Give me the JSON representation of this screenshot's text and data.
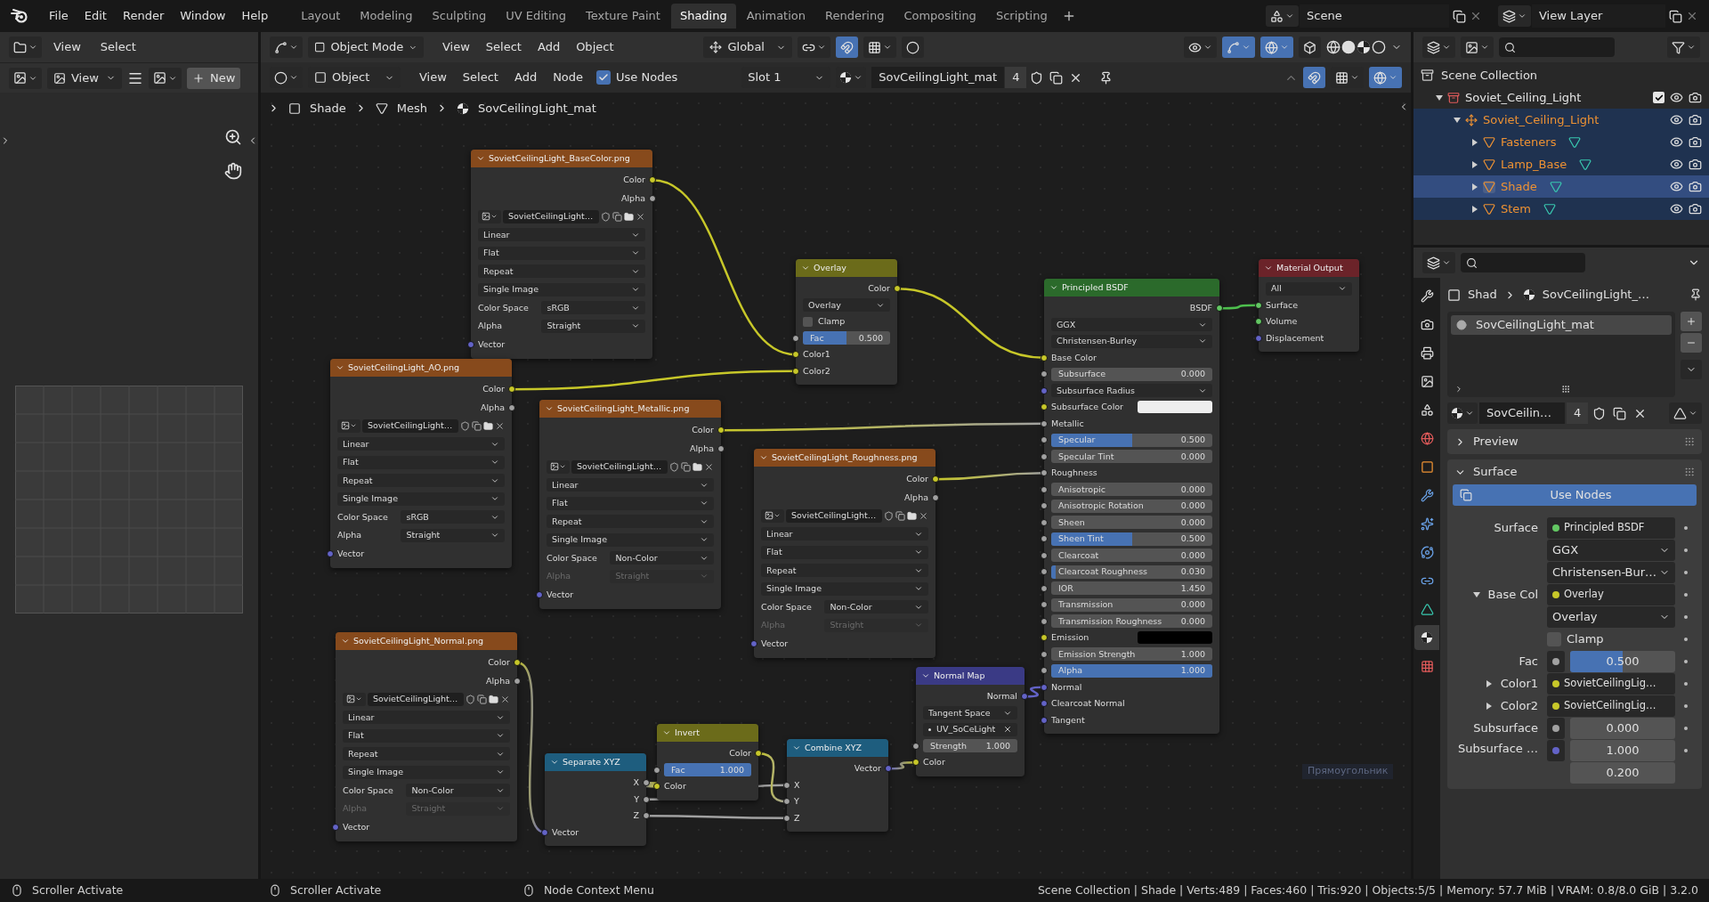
{
  "menu": [
    "File",
    "Edit",
    "Render",
    "Window",
    "Help"
  ],
  "workspaces": [
    {
      "label": "Layout",
      "selected": false
    },
    {
      "label": "Modeling",
      "selected": false
    },
    {
      "label": "Sculpting",
      "selected": false
    },
    {
      "label": "UV Editing",
      "selected": false
    },
    {
      "label": "Texture Paint",
      "selected": false
    },
    {
      "label": "Shading",
      "selected": true
    },
    {
      "label": "Animation",
      "selected": false
    },
    {
      "label": "Rendering",
      "selected": false
    },
    {
      "label": "Compositing",
      "selected": false
    },
    {
      "label": "Scripting",
      "selected": false
    }
  ],
  "scene": "Scene",
  "view_layer": "View Layer",
  "image_editor": {
    "menus": [
      "View",
      "Select"
    ],
    "view": "View",
    "new_button": "New"
  },
  "node_editor": {
    "mode": "Object Mode",
    "menus": [
      "View",
      "Select",
      "Add",
      "Object"
    ],
    "orientation": "Global",
    "shader_type": "Object",
    "node_menus": [
      "View",
      "Select",
      "Add",
      "Node"
    ],
    "use_nodes": {
      "label": "Use Nodes",
      "checked": true
    },
    "slot": "Slot 1",
    "material": "SovCeilingLight_mat",
    "users": "4",
    "breadcrumbs": [
      "Shade",
      "Mesh",
      "SovCeilingLight_mat"
    ],
    "nodes": [
      {
        "title": "SovietCeilingLight_BaseColor.png",
        "kind": "texture",
        "rows": [
          {
            "kind": "output",
            "label": "Color",
            "socket": {
              "color": "#c7c729"
            }
          },
          {
            "kind": "output",
            "label": "Alpha",
            "socket": {
              "color": "#a1a1a1"
            }
          },
          {
            "kind": "image",
            "value": "SovietCeilingLight…"
          },
          {
            "kind": "dropdown",
            "value": "Linear"
          },
          {
            "kind": "dropdown",
            "value": "Flat"
          },
          {
            "kind": "dropdown",
            "value": "Repeat"
          },
          {
            "kind": "dropdown",
            "value": "Single Image"
          },
          {
            "kind": "field",
            "label": "Color Space",
            "value": "sRGB",
            "disabled": false
          },
          {
            "kind": "field",
            "label": "Alpha",
            "value": "Straight",
            "disabled": false
          },
          {
            "kind": "input",
            "label": "Vector",
            "socket": {
              "color": "#6363c7"
            }
          }
        ]
      },
      {
        "title": "SovietCeilingLight_AO.png",
        "kind": "texture",
        "rows": [
          {
            "kind": "output",
            "label": "Color",
            "socket": {
              "color": "#c7c729"
            }
          },
          {
            "kind": "output",
            "label": "Alpha",
            "socket": {
              "color": "#a1a1a1"
            }
          },
          {
            "kind": "image",
            "value": "SovietCeilingLight…"
          },
          {
            "kind": "dropdown",
            "value": "Linear"
          },
          {
            "kind": "dropdown",
            "value": "Flat"
          },
          {
            "kind": "dropdown",
            "value": "Repeat"
          },
          {
            "kind": "dropdown",
            "value": "Single Image"
          },
          {
            "kind": "field",
            "label": "Color Space",
            "value": "sRGB",
            "disabled": false
          },
          {
            "kind": "field",
            "label": "Alpha",
            "value": "Straight",
            "disabled": false
          },
          {
            "kind": "input",
            "label": "Vector",
            "socket": {
              "color": "#6363c7"
            }
          }
        ]
      },
      {
        "title": "SovietCeilingLight_Metallic.png",
        "kind": "texture",
        "rows": [
          {
            "kind": "output",
            "label": "Color",
            "socket": {
              "color": "#c7c729"
            }
          },
          {
            "kind": "output",
            "label": "Alpha",
            "socket": {
              "color": "#a1a1a1"
            }
          },
          {
            "kind": "image",
            "value": "SovietCeilingLight…"
          },
          {
            "kind": "dropdown",
            "value": "Linear"
          },
          {
            "kind": "dropdown",
            "value": "Flat"
          },
          {
            "kind": "dropdown",
            "value": "Repeat"
          },
          {
            "kind": "dropdown",
            "value": "Single Image"
          },
          {
            "kind": "field",
            "label": "Color Space",
            "value": "Non-Color",
            "disabled": false
          },
          {
            "kind": "field",
            "label": "Alpha",
            "value": "Straight",
            "disabled": true
          },
          {
            "kind": "input",
            "label": "Vector",
            "socket": {
              "color": "#6363c7"
            }
          }
        ]
      },
      {
        "title": "SovietCeilingLight_Roughness.png",
        "kind": "texture",
        "rows": [
          {
            "kind": "output",
            "label": "Color",
            "socket": {
              "color": "#c7c729"
            }
          },
          {
            "kind": "output",
            "label": "Alpha",
            "socket": {
              "color": "#a1a1a1"
            }
          },
          {
            "kind": "image",
            "value": "SovietCeilingLight…"
          },
          {
            "kind": "dropdown",
            "value": "Linear"
          },
          {
            "kind": "dropdown",
            "value": "Flat"
          },
          {
            "kind": "dropdown",
            "value": "Repeat"
          },
          {
            "kind": "dropdown",
            "value": "Single Image"
          },
          {
            "kind": "field",
            "label": "Color Space",
            "value": "Non-Color",
            "disabled": false
          },
          {
            "kind": "field",
            "label": "Alpha",
            "value": "Straight",
            "disabled": true
          },
          {
            "kind": "input",
            "label": "Vector",
            "socket": {
              "color": "#6363c7"
            }
          }
        ]
      },
      {
        "title": "SovietCeilingLight_Normal.png",
        "kind": "texture",
        "rows": [
          {
            "kind": "output",
            "label": "Color",
            "socket": {
              "color": "#c7c729"
            }
          },
          {
            "kind": "output",
            "label": "Alpha",
            "socket": {
              "color": "#a1a1a1"
            }
          },
          {
            "kind": "image",
            "value": "SovietCeilingLight…"
          },
          {
            "kind": "dropdown",
            "value": "Linear"
          },
          {
            "kind": "dropdown",
            "value": "Flat"
          },
          {
            "kind": "dropdown",
            "value": "Repeat"
          },
          {
            "kind": "dropdown",
            "value": "Single Image"
          },
          {
            "kind": "field",
            "label": "Color Space",
            "value": "Non-Color",
            "disabled": false
          },
          {
            "kind": "field",
            "label": "Alpha",
            "value": "Straight",
            "disabled": true
          },
          {
            "kind": "input",
            "label": "Vector",
            "socket": {
              "color": "#6363c7"
            }
          }
        ]
      },
      {
        "title": "Overlay",
        "kind": "color",
        "rows": [
          {
            "kind": "output",
            "label": "Color",
            "socket": {
              "color": "#c7c729"
            }
          },
          {
            "kind": "dropdown",
            "value": "Overlay"
          },
          {
            "kind": "checkbox",
            "label": "Clamp",
            "checked": false
          },
          {
            "kind": "slider",
            "label": "Fac",
            "value": "0.500",
            "level": 0.5,
            "socket": {
              "color": "#a1a1a1"
            }
          },
          {
            "kind": "input",
            "label": "Color1",
            "socket": {
              "color": "#c7c729"
            }
          },
          {
            "kind": "input",
            "label": "Color2",
            "socket": {
              "color": "#c7c729"
            }
          }
        ]
      },
      {
        "title": "Separate XYZ",
        "kind": "converter",
        "rows": [
          {
            "kind": "output",
            "label": "X",
            "socket": {
              "color": "#a1a1a1"
            }
          },
          {
            "kind": "output",
            "label": "Y",
            "socket": {
              "color": "#a1a1a1"
            }
          },
          {
            "kind": "output",
            "label": "Z",
            "socket": {
              "color": "#a1a1a1"
            }
          },
          {
            "kind": "input",
            "label": "Vector",
            "socket": {
              "color": "#6363c7"
            }
          }
        ]
      },
      {
        "title": "Invert",
        "kind": "color",
        "rows": [
          {
            "kind": "output",
            "label": "Color",
            "socket": {
              "color": "#c7c729"
            }
          },
          {
            "kind": "slider",
            "label": "Fac",
            "value": "1.000",
            "level": 1,
            "socket": {
              "color": "#a1a1a1"
            }
          },
          {
            "kind": "input",
            "label": "Color",
            "socket": {
              "color": "#c7c729"
            }
          }
        ]
      },
      {
        "title": "Combine XYZ",
        "kind": "converter",
        "rows": [
          {
            "kind": "output",
            "label": "Vector",
            "socket": {
              "color": "#6363c7"
            }
          },
          {
            "kind": "input",
            "label": "X",
            "socket": {
              "color": "#a1a1a1"
            }
          },
          {
            "kind": "input",
            "label": "Y",
            "socket": {
              "color": "#a1a1a1"
            }
          },
          {
            "kind": "input",
            "label": "Z",
            "socket": {
              "color": "#a1a1a1"
            }
          }
        ]
      },
      {
        "title": "Normal Map",
        "kind": "vector",
        "rows": [
          {
            "kind": "output",
            "label": "Normal",
            "socket": {
              "color": "#6363c7"
            }
          },
          {
            "kind": "dropdown",
            "value": "Tangent Space"
          },
          {
            "kind": "uvmap",
            "value": "UV_SoCeLight"
          },
          {
            "kind": "number",
            "label": "Strength",
            "value": "1.000",
            "socket": {
              "color": "#a1a1a1"
            }
          },
          {
            "kind": "input",
            "label": "Color",
            "socket": {
              "color": "#c7c729"
            }
          }
        ]
      },
      {
        "title": "Principled BSDF",
        "kind": "shader",
        "rows": [
          {
            "kind": "output",
            "label": "BSDF",
            "socket": {
              "color": "#63c763"
            }
          },
          {
            "kind": "dropdown",
            "value": "GGX"
          },
          {
            "kind": "dropdown",
            "value": "Christensen-Burley"
          },
          {
            "kind": "input",
            "label": "Base Color",
            "socket": {
              "color": "#c7c729"
            }
          },
          {
            "kind": "number",
            "label": "Subsurface",
            "value": "0.000",
            "socket": {
              "color": "#a1a1a1"
            }
          },
          {
            "kind": "dropdown",
            "value": "Subsurface Radius",
            "socket": {
              "color": "#6363c7"
            }
          },
          {
            "kind": "swatch",
            "label": "Subsurface Color",
            "color": "#eeeeee",
            "socket": {
              "color": "#c7c729"
            }
          },
          {
            "kind": "input",
            "label": "Metallic",
            "socket": {
              "color": "#a1a1a1"
            }
          },
          {
            "kind": "slider",
            "label": "Specular",
            "value": "0.500",
            "level": 0.5,
            "socket": {
              "color": "#a1a1a1"
            }
          },
          {
            "kind": "number",
            "label": "Specular Tint",
            "value": "0.000",
            "socket": {
              "color": "#a1a1a1"
            }
          },
          {
            "kind": "input",
            "label": "Roughness",
            "socket": {
              "color": "#a1a1a1"
            }
          },
          {
            "kind": "number",
            "label": "Anisotropic",
            "value": "0.000",
            "socket": {
              "color": "#a1a1a1"
            }
          },
          {
            "kind": "number",
            "label": "Anisotropic Rotation",
            "value": "0.000",
            "socket": {
              "color": "#a1a1a1"
            }
          },
          {
            "kind": "number",
            "label": "Sheen",
            "value": "0.000",
            "socket": {
              "color": "#a1a1a1"
            }
          },
          {
            "kind": "slider",
            "label": "Sheen Tint",
            "value": "0.500",
            "level": 0.5,
            "socket": {
              "color": "#a1a1a1"
            }
          },
          {
            "kind": "number",
            "label": "Clearcoat",
            "value": "0.000",
            "socket": {
              "color": "#a1a1a1"
            }
          },
          {
            "kind": "slider",
            "label": "Clearcoat Roughness",
            "value": "0.030",
            "level": 0.03,
            "socket": {
              "color": "#a1a1a1"
            }
          },
          {
            "kind": "number",
            "label": "IOR",
            "value": "1.450",
            "socket": {
              "color": "#a1a1a1"
            }
          },
          {
            "kind": "number",
            "label": "Transmission",
            "value": "0.000",
            "socket": {
              "color": "#a1a1a1"
            }
          },
          {
            "kind": "number",
            "label": "Transmission Roughness",
            "value": "0.000",
            "socket": {
              "color": "#a1a1a1"
            }
          },
          {
            "kind": "swatch",
            "label": "Emission",
            "color": "#000000",
            "socket": {
              "color": "#c7c729"
            }
          },
          {
            "kind": "number",
            "label": "Emission Strength",
            "value": "1.000",
            "socket": {
              "color": "#a1a1a1"
            }
          },
          {
            "kind": "slider",
            "label": "Alpha",
            "value": "1.000",
            "level": 1,
            "socket": {
              "color": "#a1a1a1"
            }
          },
          {
            "kind": "input",
            "label": "Normal",
            "socket": {
              "color": "#6363c7"
            }
          },
          {
            "kind": "input",
            "label": "Clearcoat Normal",
            "socket": {
              "color": "#6363c7"
            }
          },
          {
            "kind": "input",
            "label": "Tangent",
            "socket": {
              "color": "#6363c7"
            }
          }
        ]
      },
      {
        "title": "Material Output",
        "kind": "output",
        "rows": [
          {
            "kind": "dropdown",
            "value": "All"
          },
          {
            "kind": "input",
            "label": "Surface",
            "socket": {
              "color": "#63c763"
            }
          },
          {
            "kind": "input",
            "label": "Volume",
            "socket": {
              "color": "#63c763"
            }
          },
          {
            "kind": "input",
            "label": "Displacement",
            "socket": {
              "color": "#6363c7"
            }
          }
        ]
      }
    ],
    "hint": "Прямоугольник"
  },
  "outliner": {
    "root": "Scene Collection",
    "tree": [
      {
        "label": "Soviet_Ceiling_Light",
        "kind": "collection",
        "checked": true,
        "selected": false,
        "active": false,
        "expanded": true,
        "children": [
          {
            "label": "Soviet_Ceiling_Light",
            "kind": "empty",
            "selected": true,
            "active": false,
            "expanded": true,
            "children": [
              {
                "label": "Fasteners",
                "kind": "mesh",
                "selected": true,
                "active": false,
                "expanded": false
              },
              {
                "label": "Lamp_Base",
                "kind": "mesh",
                "selected": true,
                "active": false,
                "expanded": false
              },
              {
                "label": "Shade",
                "kind": "mesh",
                "selected": true,
                "active": true,
                "expanded": false
              },
              {
                "label": "Stem",
                "kind": "mesh",
                "selected": true,
                "active": false,
                "expanded": false
              }
            ]
          }
        ]
      }
    ]
  },
  "properties": {
    "tabs": [
      {
        "kind": "tool",
        "selected": false
      },
      {
        "kind": "render",
        "selected": false
      },
      {
        "kind": "output",
        "selected": false
      },
      {
        "kind": "view_layer",
        "selected": false
      },
      {
        "kind": "scene",
        "selected": false
      },
      {
        "kind": "world",
        "selected": false
      },
      {
        "kind": "object",
        "selected": false
      },
      {
        "kind": "modifiers",
        "selected": false
      },
      {
        "kind": "particles",
        "selected": false
      },
      {
        "kind": "physics",
        "selected": false
      },
      {
        "kind": "constraints",
        "selected": false
      },
      {
        "kind": "data",
        "selected": false
      },
      {
        "kind": "material",
        "selected": true
      },
      {
        "kind": "texture",
        "selected": false
      }
    ],
    "breadcrumb": [
      "Shad",
      "SovCeilingLight_…"
    ],
    "slots": [
      {
        "label": "SovCeilingLight_mat",
        "selected": true
      }
    ],
    "material": "SovCeilin…",
    "users": "4",
    "panels": [
      {
        "title": "Preview",
        "expanded": false
      },
      {
        "title": "Surface",
        "expanded": true
      }
    ],
    "use_nodes": "Use Nodes",
    "rows": [
      {
        "kind": "link",
        "label": "Surface",
        "value": "Principled BSDF",
        "socket": {
          "color": "#63c763"
        }
      },
      {
        "kind": "dropdown",
        "value": "GGX"
      },
      {
        "kind": "dropdown",
        "value": "Christensen-Bur…"
      },
      {
        "kind": "link",
        "label": "Base Col",
        "value": "Overlay",
        "socket": {
          "color": "#c7c729"
        },
        "expanded": true
      },
      {
        "kind": "dropdown",
        "value": "Overlay"
      },
      {
        "kind": "checkbox",
        "label": "Clamp",
        "checked": false
      },
      {
        "kind": "slider",
        "label": "Fac",
        "value": "0.500",
        "level": 0.5,
        "socket": {
          "color": "#a1a1a1"
        }
      },
      {
        "kind": "link",
        "label": "Color1",
        "value": "SovietCeilingLig…",
        "socket": {
          "color": "#c7c729"
        },
        "expanded": false
      },
      {
        "kind": "link",
        "label": "Color2",
        "value": "SovietCeilingLig…",
        "socket": {
          "color": "#c7c729"
        },
        "expanded": false
      },
      {
        "kind": "number",
        "label": "Subsurface",
        "value": "0.000",
        "socket": {
          "color": "#a1a1a1"
        }
      },
      {
        "kind": "vector",
        "label": "Subsurface …",
        "values": [
          "1.000",
          "0.200"
        ],
        "socket": {
          "color": "#6363c7"
        }
      }
    ]
  },
  "status_bar": {
    "hints": [
      "Scroller Activate",
      "Scroller Activate",
      "Node Context Menu"
    ],
    "stats": "Scene Collection | Shade | Verts:489 | Faces:460 | Tris:920 | Objects:5/5 | Memory: 57.7 MiB | VRAM: 0.8/8.0 GiB | 3.2.0"
  }
}
